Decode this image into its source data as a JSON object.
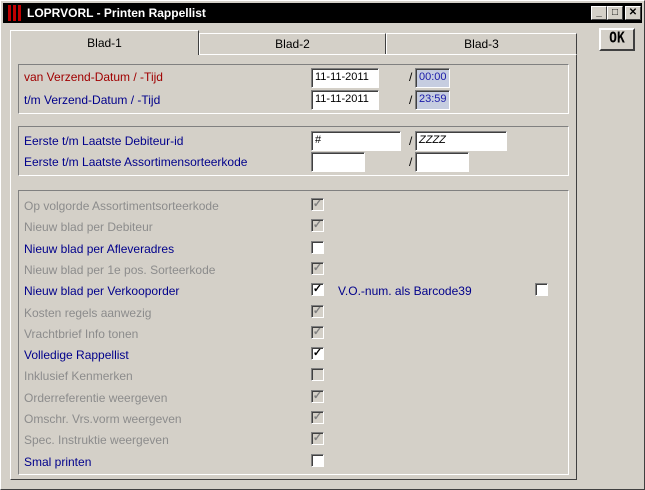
{
  "window": {
    "title": "LOPRVORL - Printen Rappellist",
    "minimize": "_",
    "maximize": "□",
    "close": "✕"
  },
  "ok_button": "OK",
  "tabs": [
    {
      "label": "Blad-1",
      "active": true
    },
    {
      "label": "Blad-2",
      "active": false
    },
    {
      "label": "Blad-3",
      "active": false
    }
  ],
  "dates": {
    "van_label": "van Verzend-Datum / -Tijd",
    "tm_label": "t/m Verzend-Datum / -Tijd",
    "van_date": "11-11-2011",
    "van_time": "00:00",
    "tm_date": "11-11-2011",
    "tm_time": "23:59",
    "separator": "/"
  },
  "ranges": {
    "debiteur_label": "Eerste t/m Laatste Debiteur-id",
    "assort_label": "Eerste t/m Laatste Assortimensorteerkode",
    "debiteur_from": "#",
    "debiteur_to": "ZZZZ",
    "assort_from": "",
    "assort_to": "",
    "separator": "/"
  },
  "options": [
    {
      "label": "Op volgorde Assortimentsorteerkode",
      "enabled": false,
      "checked": true
    },
    {
      "label": "Nieuw blad per Debiteur",
      "enabled": false,
      "checked": true
    },
    {
      "label": "Nieuw blad per Afleveradres",
      "enabled": true,
      "checked": false
    },
    {
      "label": "Nieuw blad per 1e pos. Sorteerkode",
      "enabled": false,
      "checked": true
    },
    {
      "label": "Nieuw blad per Verkooporder",
      "enabled": true,
      "checked": true
    },
    {
      "label": "Kosten regels aanwezig",
      "enabled": false,
      "checked": true
    },
    {
      "label": "Vrachtbrief Info tonen",
      "enabled": false,
      "checked": true
    },
    {
      "label": "Volledige Rappellist",
      "enabled": true,
      "checked": true
    },
    {
      "label": "Inklusief Kenmerken",
      "enabled": false,
      "checked": false
    },
    {
      "label": "Orderreferentie weergeven",
      "enabled": false,
      "checked": true
    },
    {
      "label": "Omschr. Vrs.vorm weergeven",
      "enabled": false,
      "checked": true
    },
    {
      "label": "Spec. Instruktie weergeven",
      "enabled": false,
      "checked": true
    },
    {
      "label": "Smal printen",
      "enabled": true,
      "checked": false
    }
  ],
  "barcode_option": {
    "label": "V.O.-num. als Barcode39",
    "enabled": true,
    "checked": false
  },
  "colors": {
    "date_label": "#a00000",
    "label": "#00008b",
    "disabled_label": "#8c8c8c",
    "time_field": "#c6cde0"
  }
}
